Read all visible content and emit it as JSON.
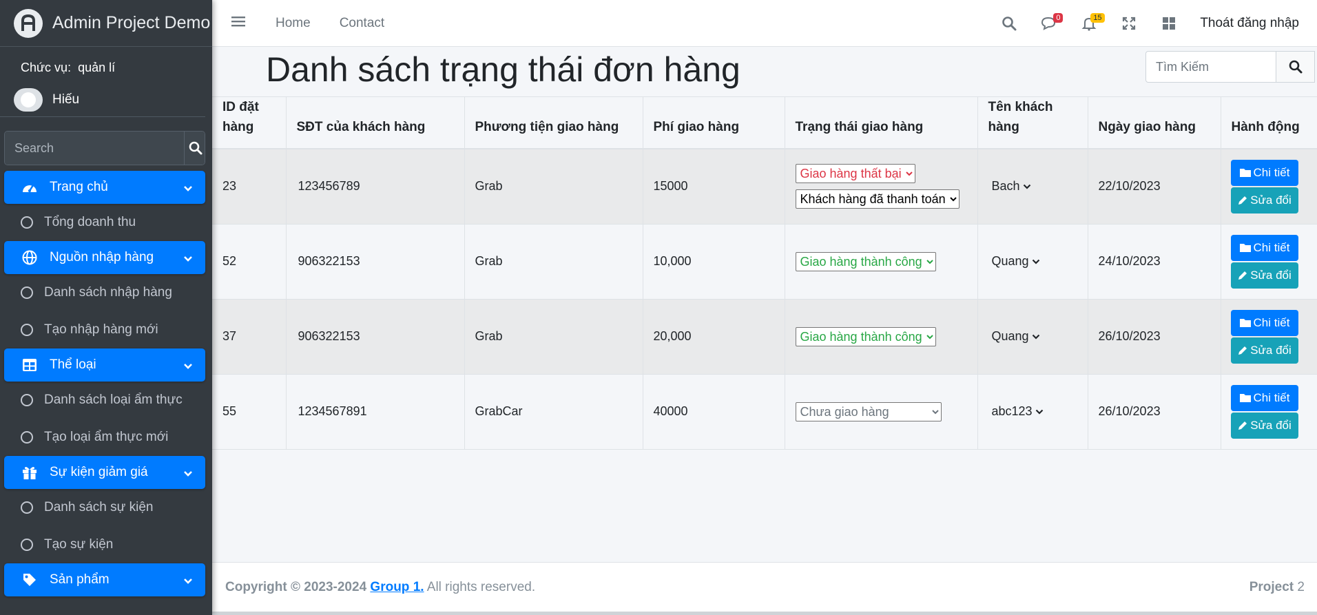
{
  "brand": {
    "name": "Admin Project Demo"
  },
  "sidebar": {
    "role_label": "Chức vụ:",
    "role_value": "quản lí",
    "user_name": "Hiếu",
    "search_placeholder": "Search",
    "sections": [
      {
        "label": "Trang chủ",
        "icon": "dashboard-icon",
        "items": [
          "Tổng doanh thu"
        ]
      },
      {
        "label": "Nguồn nhập hàng",
        "icon": "globe-icon",
        "items": [
          "Danh sách nhập hàng",
          "Tạo nhập hàng mới"
        ]
      },
      {
        "label": "Thể loại",
        "icon": "table-icon",
        "items": [
          "Danh sách loại ẩm thực",
          "Tạo loại ẩm thực mới"
        ]
      },
      {
        "label": "Sự kiện giảm giá",
        "icon": "gift-icon",
        "items": [
          "Danh sách sự kiện",
          "Tạo sự kiện"
        ]
      },
      {
        "label": "Sản phẩm",
        "icon": "tag-icon",
        "items": []
      }
    ]
  },
  "topbar": {
    "links": [
      "Home",
      "Contact"
    ],
    "messages_badge": "0",
    "notifications_badge": "15",
    "logout_label": "Thoát đăng nhập",
    "colors": {
      "danger": "#dc3545",
      "warning": "#ffc107"
    }
  },
  "main": {
    "title": "Danh sách trạng thái đơn hàng",
    "search_placeholder": "Tìm Kiếm",
    "table": {
      "headers": {
        "id": "ID đặt hàng",
        "phone": "SĐT của khách hàng",
        "vehicle": "Phương tiện giao hàng",
        "fee": "Phí giao hàng",
        "status": "Trạng thái giao hàng",
        "customer": "Tên khách hàng",
        "date": "Ngày giao hàng",
        "action": "Hành động"
      },
      "rows": [
        {
          "id": "23",
          "phone": "123456789",
          "vehicle": "Grab",
          "fee": "15000",
          "status": "Giao hàng thất bại",
          "payment": "Khách hàng đã thanh toán",
          "customer": "Bach",
          "date": "22/10/2023"
        },
        {
          "id": "52",
          "phone": "906322153",
          "vehicle": "Grab",
          "fee": "10,000",
          "status": "Giao hàng thành công",
          "customer": "Quang",
          "date": "24/10/2023"
        },
        {
          "id": "37",
          "phone": "906322153",
          "vehicle": "Grab",
          "fee": "20,000",
          "status": "Giao hàng thành công",
          "customer": "Quang",
          "date": "26/10/2023"
        },
        {
          "id": "55",
          "phone": "1234567891",
          "vehicle": "GrabCar",
          "fee": "40000",
          "status": "Chưa giao hàng",
          "customer": "abc123",
          "date": "26/10/2023"
        }
      ],
      "detail_label": "Chi tiết",
      "edit_label": "Sửa đổi"
    }
  },
  "footer": {
    "copyright": "Copyright © 2023-2024",
    "group_link": "Group 1.",
    "rights": "All rights reserved.",
    "project_label": "Project",
    "project_version": "2"
  }
}
